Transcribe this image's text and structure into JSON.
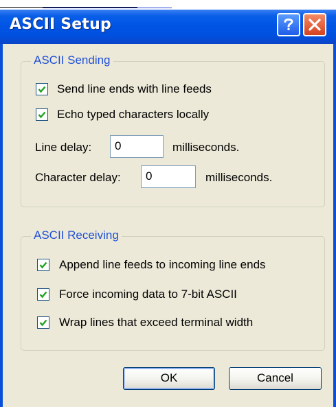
{
  "window": {
    "title": "ASCII Setup"
  },
  "titlebar": {
    "help_icon": "help-question-icon",
    "close_icon": "close-x-icon"
  },
  "sending": {
    "legend": "ASCII Sending",
    "send_line_ends": {
      "label": "Send line ends with line feeds",
      "checked": true
    },
    "echo_local": {
      "label": "Echo typed characters locally",
      "checked": true
    },
    "line_delay": {
      "label": "Line delay:",
      "value": "0",
      "unit": "milliseconds."
    },
    "char_delay": {
      "label": "Character delay:",
      "value": "0",
      "unit": "milliseconds."
    }
  },
  "receiving": {
    "legend": "ASCII Receiving",
    "append_lf": {
      "label": "Append line feeds to incoming line ends",
      "checked": true
    },
    "force_7bit": {
      "label": "Force incoming data to 7-bit ASCII",
      "checked": true
    },
    "wrap_lines": {
      "label": "Wrap lines that exceed terminal width",
      "checked": true
    }
  },
  "buttons": {
    "ok": "OK",
    "cancel": "Cancel"
  },
  "colors": {
    "title_bar": "#0055e5",
    "legend_text": "#1e4fd8",
    "dialog_bg": "#ece9d8",
    "check_mark": "#21a121"
  }
}
